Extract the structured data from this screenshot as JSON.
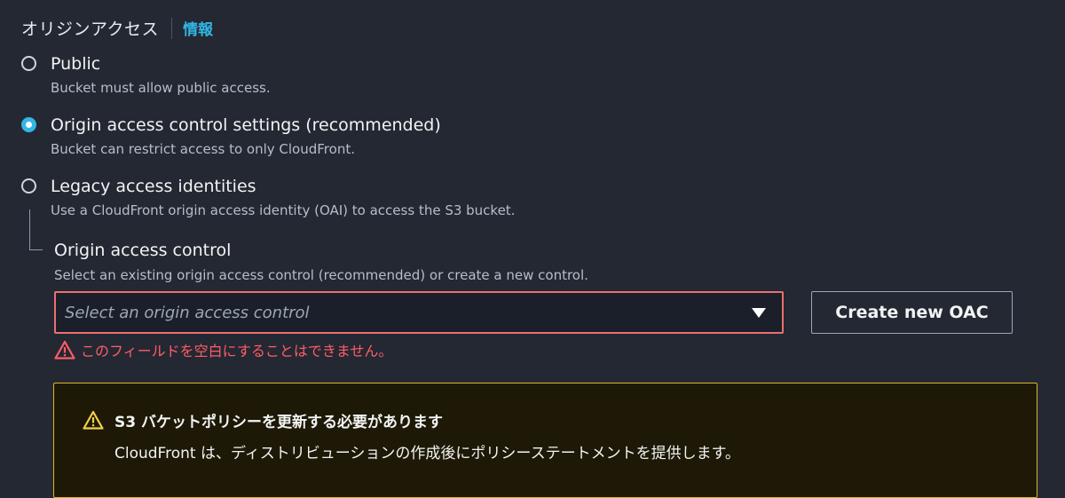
{
  "section": {
    "title": "オリジンアクセス",
    "info_link": "情報"
  },
  "options": [
    {
      "label": "Public",
      "description": "Bucket must allow public access.",
      "selected": false
    },
    {
      "label": "Origin access control settings (recommended)",
      "description": "Bucket can restrict access to only CloudFront.",
      "selected": true
    },
    {
      "label": "Legacy access identities",
      "description": "Use a CloudFront origin access identity (OAI) to access the S3 bucket.",
      "selected": false
    }
  ],
  "oac_field": {
    "label": "Origin access control",
    "description": "Select an existing origin access control (recommended) or create a new control.",
    "select_placeholder": "Select an origin access control",
    "create_button": "Create new OAC",
    "error": "このフィールドを空白にすることはできません。"
  },
  "alert": {
    "title": "S3 バケットポリシーを更新する必要があります",
    "body": "CloudFront は、ディストリビューションの作成後にポリシーステートメントを提供します。"
  },
  "icons": {
    "error": "warning-triangle-icon",
    "alert": "warning-triangle-icon"
  },
  "colors": {
    "background": "#232833",
    "accent": "#33b6e6",
    "error": "#eb6f6f",
    "warning": "#dfb52c"
  }
}
